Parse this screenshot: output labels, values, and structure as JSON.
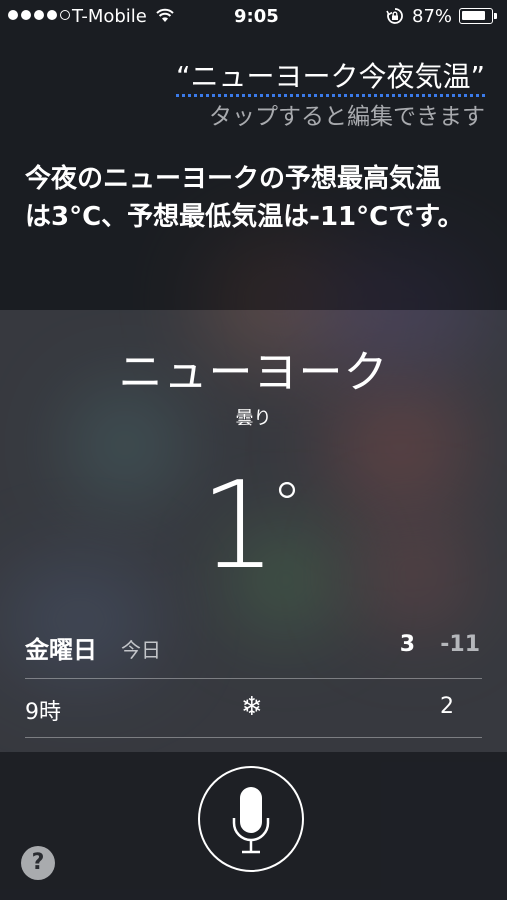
{
  "status_bar": {
    "carrier": "T-Mobile",
    "time": "9:05",
    "battery_percent": "87%",
    "battery_level": 0.87,
    "signal_bars_filled": 4,
    "signal_bars_total": 5,
    "icons": [
      "wifi-icon",
      "rotation-lock-icon",
      "battery-icon"
    ]
  },
  "siri": {
    "query": "“ニューヨーク今夜気温”",
    "query_hint": "タップすると編集できます",
    "answer": "今夜のニューヨークの予想最高気温は3°C、予想最低気温は-11°Cです。"
  },
  "weather": {
    "city": "ニューヨーク",
    "condition": "曇り",
    "current_temp": "1",
    "degree_symbol": "°",
    "day": {
      "name": "金曜日",
      "today_label": "今日",
      "high": "3",
      "low": "-11"
    },
    "hourly": [
      {
        "time": "9時",
        "icon": "snowflake-icon",
        "glyph": "❄",
        "temp": "2"
      }
    ]
  },
  "controls": {
    "help_label": "?",
    "mic_icon": "microphone-icon"
  },
  "colors": {
    "query_underline": "#3b7bea",
    "hint_text": "#a8aaae"
  }
}
